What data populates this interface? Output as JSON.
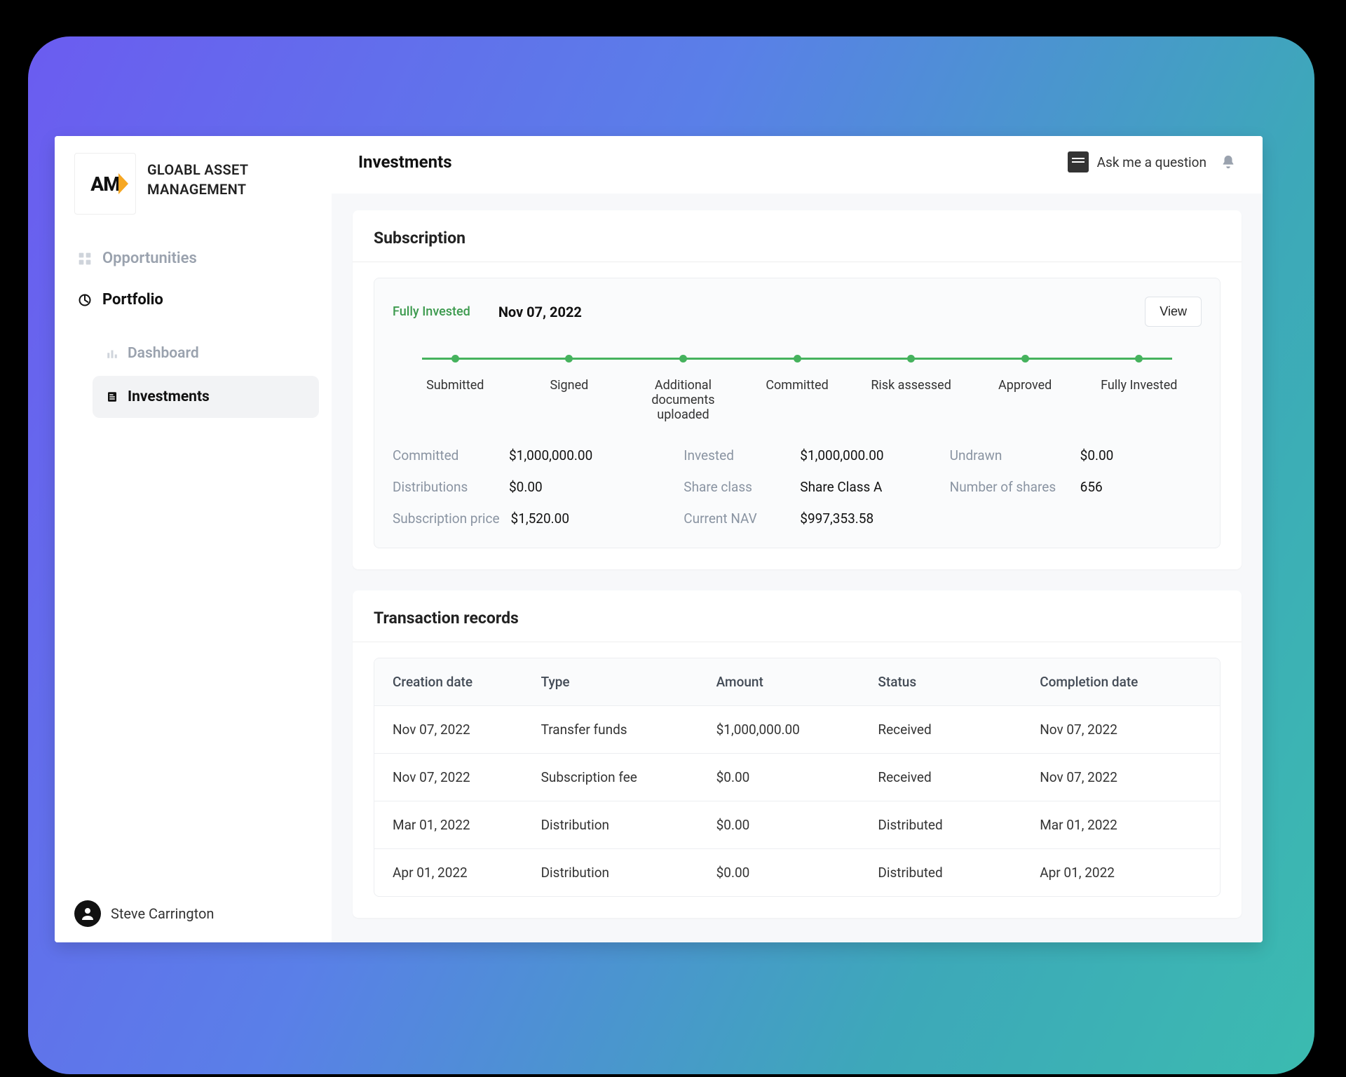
{
  "brand": {
    "logo_text": "AM",
    "name_line1": "GLOABL ASSET",
    "name_line2": "MANAGEMENT"
  },
  "nav": {
    "opportunities": "Opportunities",
    "portfolio": "Portfolio",
    "dashboard": "Dashboard",
    "investments": "Investments"
  },
  "user": {
    "name": "Steve Carrington"
  },
  "topbar": {
    "title": "Investments",
    "ask": "Ask me a question"
  },
  "subscription": {
    "title": "Subscription",
    "status": "Fully Invested",
    "date": "Nov 07, 2022",
    "view": "View",
    "steps": [
      "Submitted",
      "Signed",
      "Additional documents uploaded",
      "Committed",
      "Risk assessed",
      "Approved",
      "Fully Invested"
    ],
    "kv": {
      "committed_l": "Committed",
      "committed_v": "$1,000,000.00",
      "invested_l": "Invested",
      "invested_v": "$1,000,000.00",
      "undrawn_l": "Undrawn",
      "undrawn_v": "$0.00",
      "distributions_l": "Distributions",
      "distributions_v": "$0.00",
      "shareclass_l": "Share class",
      "shareclass_v": "Share Class A",
      "numshares_l": "Number of shares",
      "numshares_v": "656",
      "subprice_l": "Subscription price",
      "subprice_v": "$1,520.00",
      "nav_l": "Current NAV",
      "nav_v": "$997,353.58"
    }
  },
  "transactions": {
    "title": "Transaction records",
    "columns": {
      "c1": "Creation date",
      "c2": "Type",
      "c3": "Amount",
      "c4": "Status",
      "c5": "Completion date"
    },
    "rows": [
      {
        "c1": "Nov 07, 2022",
        "c2": "Transfer funds",
        "c3": "$1,000,000.00",
        "c4": "Received",
        "c5": "Nov 07, 2022"
      },
      {
        "c1": "Nov 07, 2022",
        "c2": "Subscription fee",
        "c3": "$0.00",
        "c4": "Received",
        "c5": "Nov 07, 2022"
      },
      {
        "c1": "Mar 01, 2022",
        "c2": "Distribution",
        "c3": "$0.00",
        "c4": "Distributed",
        "c5": "Mar 01, 2022"
      },
      {
        "c1": "Apr 01, 2022",
        "c2": "Distribution",
        "c3": "$0.00",
        "c4": "Distributed",
        "c5": "Apr 01, 2022"
      }
    ]
  }
}
